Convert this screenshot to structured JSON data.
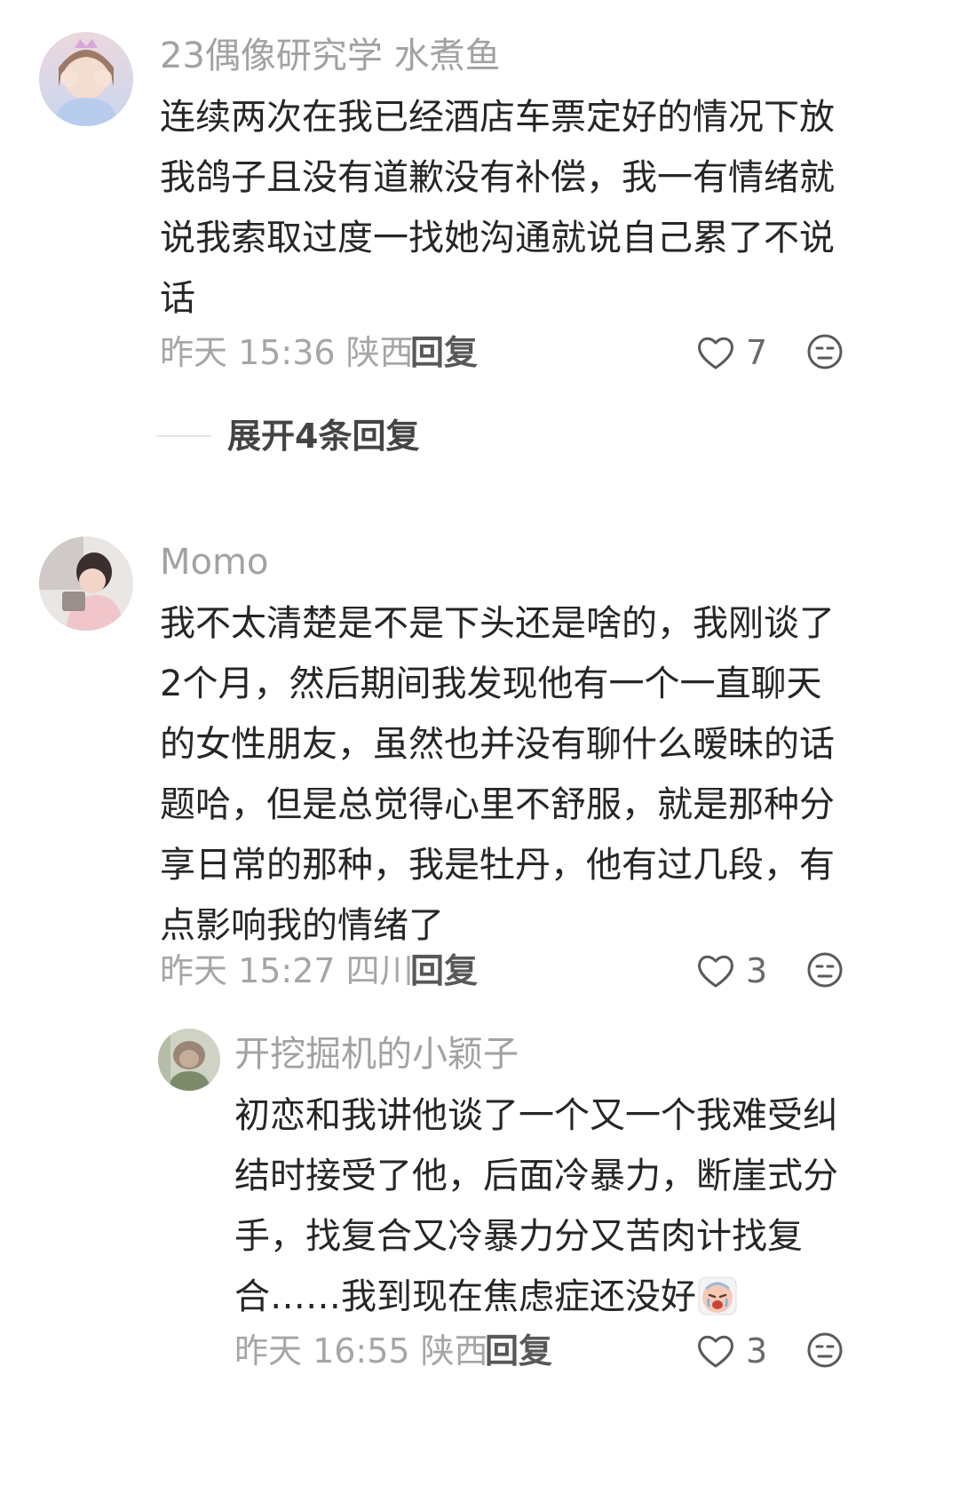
{
  "comments": [
    {
      "username": "23偶像研究学 水煮鱼",
      "text": "连续两次在我已经酒店车票定好的情况下放我鸽子且没有道歉没有补偿，我一有情绪就说我索取过度一找她沟通就说自己累了不说话",
      "time_location": "昨天 15:36 陕西",
      "reply_label": "回复",
      "likes": "7",
      "expand_label": "展开4条回复"
    },
    {
      "username": "Momo",
      "text": "我不太清楚是不是下头还是啥的，我刚谈了2个月，然后期间我发现他有一个一直聊天的女性朋友，虽然也并没有聊什么暧昧的话题哈，但是总觉得心里不舒服，就是那种分享日常的那种，我是牡丹，他有过几段，有点影响我的情绪了",
      "time_location": "昨天 15:27 四川",
      "reply_label": "回复",
      "likes": "3",
      "reply": {
        "username": "开挖掘机的小颖子",
        "text": "初恋和我讲他谈了一个又一个我难受纠结时接受了他，后面冷暴力，断崖式分手，找复合又冷暴力分又苦肉计找复合……我到现在焦虑症还没好",
        "emoji": "crying-face-emoji",
        "time_location": "昨天 16:55 陕西",
        "reply_label": "回复",
        "likes": "3"
      }
    }
  ]
}
